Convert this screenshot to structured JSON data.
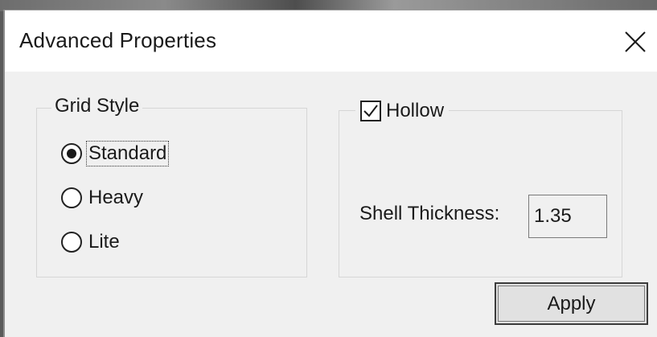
{
  "window": {
    "title": "Advanced Properties",
    "close_icon": "close-icon"
  },
  "grid_style": {
    "label": "Grid Style",
    "options": [
      {
        "label": "Standard",
        "selected": true,
        "focused": true
      },
      {
        "label": "Heavy",
        "selected": false,
        "focused": false
      },
      {
        "label": "Lite",
        "selected": false,
        "focused": false
      }
    ]
  },
  "hollow": {
    "label": "Hollow",
    "checked": true,
    "shell_thickness_label": "Shell Thickness:",
    "shell_thickness_value": "1.35"
  },
  "buttons": {
    "apply_label": "Apply"
  },
  "colors": {
    "dialog_background": "#f0f0f0",
    "titlebar_background": "#ffffff",
    "groupbox_border": "#d6d6d6",
    "button_border": "#3c3c3c"
  }
}
